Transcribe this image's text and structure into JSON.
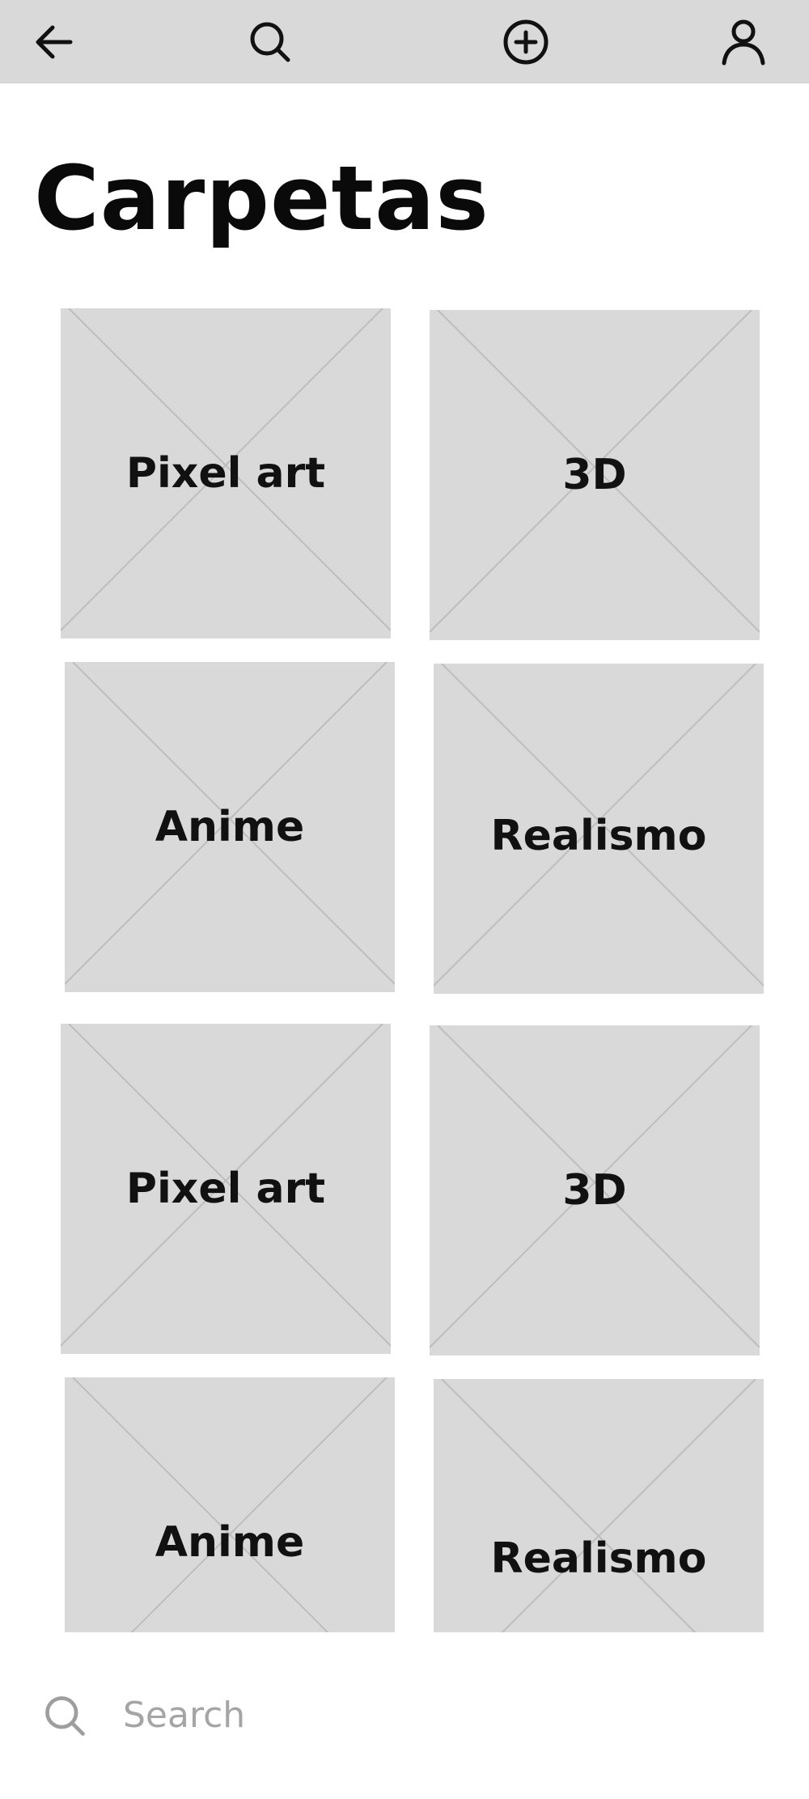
{
  "topbar": {
    "icons": [
      "back-arrow-icon",
      "search-icon",
      "add-circle-icon",
      "user-icon"
    ]
  },
  "page": {
    "title": "Carpetas"
  },
  "folders": [
    {
      "label": "Pixel art"
    },
    {
      "label": "3D"
    },
    {
      "label": "Anime"
    },
    {
      "label": "Realismo"
    },
    {
      "label": "Pixel art"
    },
    {
      "label": "3D"
    },
    {
      "label": "Anime"
    },
    {
      "label": "Realismo"
    }
  ],
  "search": {
    "placeholder": "Search",
    "value": ""
  },
  "colors": {
    "topbar_bg": "#d9d9d9",
    "tile_bg": "#d9d9d9",
    "tile_cross": "#bdbdbd",
    "text": "#0a0a0a",
    "placeholder": "#a5a5a5"
  }
}
